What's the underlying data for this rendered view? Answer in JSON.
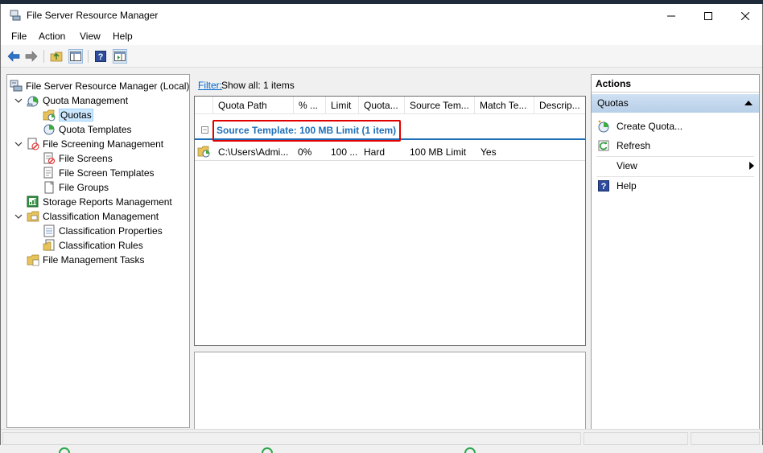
{
  "window": {
    "title": "File Server Resource Manager"
  },
  "menu": [
    "File",
    "Action",
    "View",
    "Help"
  ],
  "tree": {
    "root": "File Server Resource Manager (Local)",
    "quota_management": "Quota Management",
    "quotas": "Quotas",
    "quota_templates": "Quota Templates",
    "file_screening_management": "File Screening Management",
    "file_screens": "File Screens",
    "file_screen_templates": "File Screen Templates",
    "file_groups": "File Groups",
    "storage_reports_management": "Storage Reports Management",
    "classification_management": "Classification Management",
    "classification_properties": "Classification Properties",
    "classification_rules": "Classification Rules",
    "file_management_tasks": "File Management Tasks"
  },
  "center": {
    "filter_link": "Filter:",
    "filter_text": "Show all: 1 items",
    "columns": [
      "Quota Path",
      "% ...",
      "Limit",
      "Quota...",
      "Source Tem...",
      "Match Te...",
      "Descrip..."
    ],
    "group_title": "Source Template: 100 MB Limit (1 item)",
    "rows": [
      {
        "path": "C:\\Users\\Admi...",
        "percent": "0%",
        "limit": "100 ...",
        "type": "Hard",
        "source": "100 MB Limit",
        "match": "Yes",
        "description": ""
      }
    ]
  },
  "actions": {
    "header": "Actions",
    "section": "Quotas",
    "items": [
      "Create Quota...",
      "Refresh",
      "View",
      "Help"
    ]
  },
  "colors": {
    "selection": "#cce8ff",
    "group_blue": "#1f6fb8",
    "highlight_red": "#e00000"
  }
}
